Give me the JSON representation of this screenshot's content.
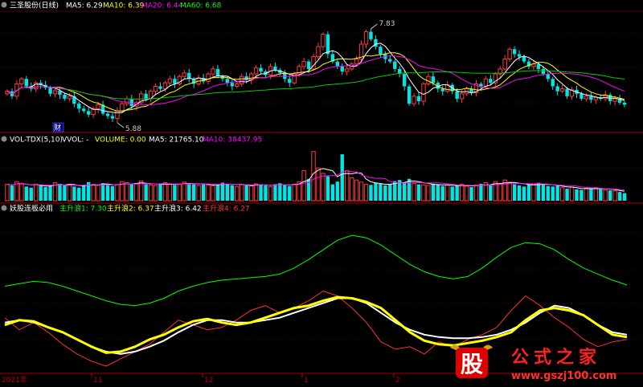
{
  "panel_price": {
    "title": "三圣股份(日线)",
    "ma_labels": [
      {
        "text": "MA5: 6.29",
        "color": "#ffffff"
      },
      {
        "text": "MA10: 6.39",
        "color": "#ffff00"
      },
      {
        "text": "MA20: 6.44",
        "color": "#ff00ff"
      },
      {
        "text": "MA60: 6.68",
        "color": "#00ff00"
      }
    ],
    "high_annotation": "7.83",
    "low_annotation": "5.88",
    "badge": "财"
  },
  "panel_volume": {
    "title": "VOL-TDX(5,10)",
    "labels": [
      {
        "text": "VVOL: -",
        "color": "#ffffff"
      },
      {
        "text": "VOLUME: 0.00",
        "color": "#ffff00"
      },
      {
        "text": "MA5: 21765.10",
        "color": "#ffffff"
      },
      {
        "text": "MA10: 38437.95",
        "color": "#ff00ff"
      }
    ]
  },
  "panel_indicator": {
    "title": "妖股连板必用",
    "labels": [
      {
        "text": "主升浪1: 7.30",
        "color": "#00ff00"
      },
      {
        "text": "主升浪2: 6.37",
        "color": "#ffff00"
      },
      {
        "text": "主升浪3: 6.42",
        "color": "#ffffff"
      },
      {
        "text": "主升浪4: 6.27",
        "color": "#ff3030"
      }
    ]
  },
  "x_axis": {
    "tick_labels": [
      "2021年",
      "11",
      "12",
      "1",
      "2"
    ]
  },
  "watermark": {
    "logo_text": "股",
    "brand": "公式之家",
    "url": "www.gszj100.com"
  },
  "chart_data": [
    {
      "type": "candlestick",
      "title": "三圣股份(日线)",
      "ylim": [
        5.7,
        8.0
      ],
      "close": [
        6.45,
        6.35,
        6.6,
        6.7,
        6.55,
        6.5,
        6.62,
        6.58,
        6.52,
        6.4,
        6.46,
        6.38,
        6.3,
        6.35,
        6.2,
        6.1,
        6.05,
        5.98,
        6.1,
        6.18,
        6.0,
        5.95,
        5.9,
        6.05,
        6.2,
        6.3,
        6.15,
        6.22,
        6.4,
        6.3,
        6.45,
        6.55,
        6.5,
        6.62,
        6.7,
        6.6,
        6.75,
        6.82,
        6.7,
        6.6,
        6.72,
        6.65,
        6.8,
        6.9,
        6.75,
        6.7,
        6.62,
        6.55,
        6.6,
        6.75,
        6.68,
        6.8,
        6.92,
        6.85,
        6.78,
        6.95,
        6.88,
        6.82,
        6.7,
        6.62,
        6.8,
        6.95,
        7.05,
        6.9,
        7.15,
        7.35,
        7.6,
        7.2,
        7.05,
        6.95,
        6.85,
        6.9,
        7.0,
        7.1,
        7.4,
        7.65,
        7.5,
        7.35,
        7.2,
        7.1,
        7.05,
        6.9,
        6.8,
        6.55,
        6.2,
        6.35,
        6.25,
        6.6,
        6.75,
        6.62,
        6.5,
        6.45,
        6.58,
        6.45,
        6.3,
        6.4,
        6.5,
        6.42,
        6.6,
        6.55,
        6.7,
        6.62,
        6.8,
        6.9,
        7.1,
        7.3,
        7.2,
        7.15,
        7.05,
        6.95,
        7.0,
        6.9,
        6.8,
        6.7,
        6.55,
        6.45,
        6.5,
        6.35,
        6.48,
        6.4,
        6.3,
        6.35,
        6.28,
        6.33,
        6.3,
        6.38,
        6.25,
        6.3,
        6.22,
        6.18
      ],
      "ma5_last": 6.29,
      "ma10_last": 6.39,
      "ma20_last": 6.44,
      "ma60_last": 6.68,
      "annotations": [
        {
          "text": "7.83",
          "kind": "high"
        },
        {
          "text": "5.88",
          "kind": "low"
        }
      ]
    },
    {
      "type": "bar",
      "title": "VOL-TDX(5,10)",
      "values": [
        30,
        28,
        35,
        32,
        26,
        24,
        30,
        29,
        25,
        27,
        33,
        31,
        28,
        30,
        26,
        24,
        29,
        34,
        30,
        28,
        32,
        30,
        27,
        29,
        35,
        33,
        30,
        31,
        36,
        30,
        29,
        28,
        30,
        33,
        31,
        29,
        30,
        34,
        32,
        30,
        28,
        31,
        29,
        27,
        30,
        33,
        31,
        28,
        26,
        30,
        29,
        27,
        31,
        30,
        28,
        26,
        30,
        32,
        29,
        27,
        30,
        35,
        55,
        40,
        90,
        60,
        50,
        45,
        30,
        35,
        85,
        55,
        42,
        38,
        34,
        30,
        29,
        33,
        31,
        28,
        30,
        36,
        38,
        34,
        40,
        32,
        30,
        29,
        28,
        31,
        30,
        27,
        29,
        26,
        28,
        30,
        27,
        25,
        29,
        31,
        33,
        28,
        35,
        30,
        38,
        34,
        30,
        28,
        26,
        30,
        31,
        33,
        29,
        27,
        26,
        28,
        24,
        22,
        25,
        21,
        20,
        23,
        22,
        24,
        21,
        20,
        19,
        18,
        16,
        14
      ],
      "ylim": [
        0,
        100
      ]
    },
    {
      "type": "line",
      "title": "妖股连板必用",
      "series": [
        {
          "name": "主升浪1",
          "color": "#00ff00",
          "values": [
            40,
            42,
            44,
            43,
            40,
            36,
            32,
            28,
            25,
            24,
            26,
            30,
            36,
            40,
            43,
            45,
            46,
            47,
            48,
            50,
            55,
            62,
            70,
            78,
            82,
            80,
            74,
            66,
            58,
            52,
            48,
            46,
            48,
            55,
            64,
            72,
            76,
            75,
            70,
            62,
            55,
            50,
            45,
            41
          ]
        },
        {
          "name": "主升浪2",
          "color": "#ffff00",
          "values": [
            8,
            12,
            11,
            6,
            2,
            -4,
            -10,
            -15,
            -14,
            -10,
            -4,
            0,
            6,
            11,
            13,
            10,
            8,
            10,
            14,
            18,
            22,
            24,
            28,
            31,
            30,
            27,
            22,
            12,
            2,
            -5,
            -8,
            -9,
            -7,
            -5,
            -2,
            2,
            12,
            20,
            22,
            20,
            16,
            8,
            0,
            -2
          ]
        },
        {
          "name": "主升浪3",
          "color": "#ffffff",
          "values": [
            10,
            12,
            10,
            6,
            2,
            -4,
            -10,
            -14,
            -16,
            -14,
            -10,
            -5,
            2,
            8,
            12,
            12,
            10,
            10,
            12,
            14,
            18,
            22,
            26,
            30,
            30,
            26,
            18,
            10,
            4,
            0,
            -2,
            -3,
            -3,
            -2,
            0,
            4,
            10,
            18,
            24,
            22,
            16,
            8,
            2,
            0
          ]
        },
        {
          "name": "主升浪4",
          "color": "#ff3030",
          "values": [
            14,
            4,
            10,
            2,
            -8,
            -16,
            -22,
            -26,
            -20,
            -14,
            -8,
            2,
            12,
            8,
            4,
            6,
            12,
            20,
            24,
            18,
            22,
            28,
            36,
            32,
            22,
            10,
            -6,
            -12,
            -10,
            -16,
            -6,
            -10,
            -4,
            0,
            6,
            20,
            32,
            24,
            14,
            6,
            -4,
            -10,
            -6,
            -4
          ]
        }
      ],
      "ylim": [
        -30,
        100
      ]
    }
  ]
}
